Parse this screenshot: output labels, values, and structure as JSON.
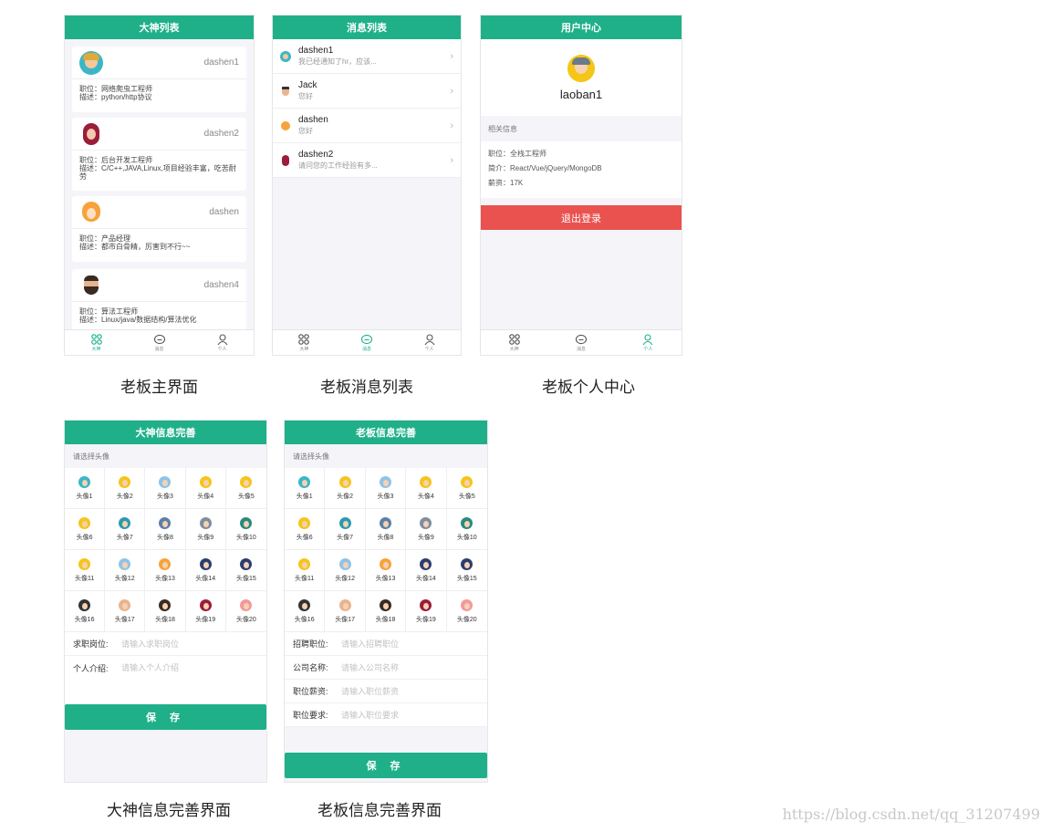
{
  "colors": {
    "accent": "#1fb08a",
    "danger": "#e9524f",
    "page_bg": "#f5f5f9"
  },
  "tabs": [
    {
      "label": "大神",
      "icon": "grid-icon"
    },
    {
      "label": "消息",
      "icon": "message-icon"
    },
    {
      "label": "个人",
      "icon": "user-icon"
    }
  ],
  "screen1": {
    "title": "大神列表",
    "caption": "老板主界面",
    "cards": [
      {
        "name": "dashen1",
        "job": "职位：网络爬虫工程师",
        "desc": "描述：python/http协议"
      },
      {
        "name": "dashen2",
        "job": "职位：后台开发工程师",
        "desc": "描述：C/C++,JAVA,Linux,项目经验丰富，吃苦耐劳"
      },
      {
        "name": "dashen",
        "job": "职位：产品经理",
        "desc": "描述：都市白骨精，厉害到不行~~"
      },
      {
        "name": "dashen4",
        "job": "职位：算法工程师",
        "desc": "描述：Linux/java/数据结构/算法优化"
      }
    ]
  },
  "screen2": {
    "title": "消息列表",
    "caption": "老板消息列表",
    "messages": [
      {
        "name": "dashen1",
        "preview": "我已经通知了hr，应该..."
      },
      {
        "name": "Jack",
        "preview": "您好"
      },
      {
        "name": "dashen",
        "preview": "您好"
      },
      {
        "name": "dashen2",
        "preview": "请问您的工作经验有多..."
      }
    ]
  },
  "screen3": {
    "title": "用户中心",
    "caption": "老板个人中心",
    "username": "laoban1",
    "section": "相关信息",
    "job": "职位：全栈工程师",
    "intro": "简介：React/Vue/jQuery/MongoDB",
    "salary": "薪资：17K",
    "logout": "退出登录"
  },
  "screen4": {
    "title": "大神信息完善",
    "caption": "大神信息完善界面",
    "hint": "请选择头像",
    "fields": [
      {
        "label": "求职岗位:",
        "placeholder": "请输入求职岗位"
      },
      {
        "label": "个人介绍:",
        "placeholder": "请输入个人介绍"
      }
    ],
    "save": "保 存"
  },
  "screen5": {
    "title": "老板信息完善",
    "caption": "老板信息完善界面",
    "hint": "请选择头像",
    "fields": [
      {
        "label": "招聘职位:",
        "placeholder": "请输入招聘职位"
      },
      {
        "label": "公司名称:",
        "placeholder": "请输入公司名称"
      },
      {
        "label": "职位薪资:",
        "placeholder": "请输入职位薪资"
      },
      {
        "label": "职位要求:",
        "placeholder": "请输入职位要求"
      }
    ],
    "save": "保 存"
  },
  "avatars": [
    "头像1",
    "头像2",
    "头像3",
    "头像4",
    "头像5",
    "头像6",
    "头像7",
    "头像8",
    "头像9",
    "头像10",
    "头像11",
    "头像12",
    "头像13",
    "头像14",
    "头像15",
    "头像16",
    "头像17",
    "头像18",
    "头像19",
    "头像20"
  ],
  "watermark": "https://blog.csdn.net/qq_31207499"
}
